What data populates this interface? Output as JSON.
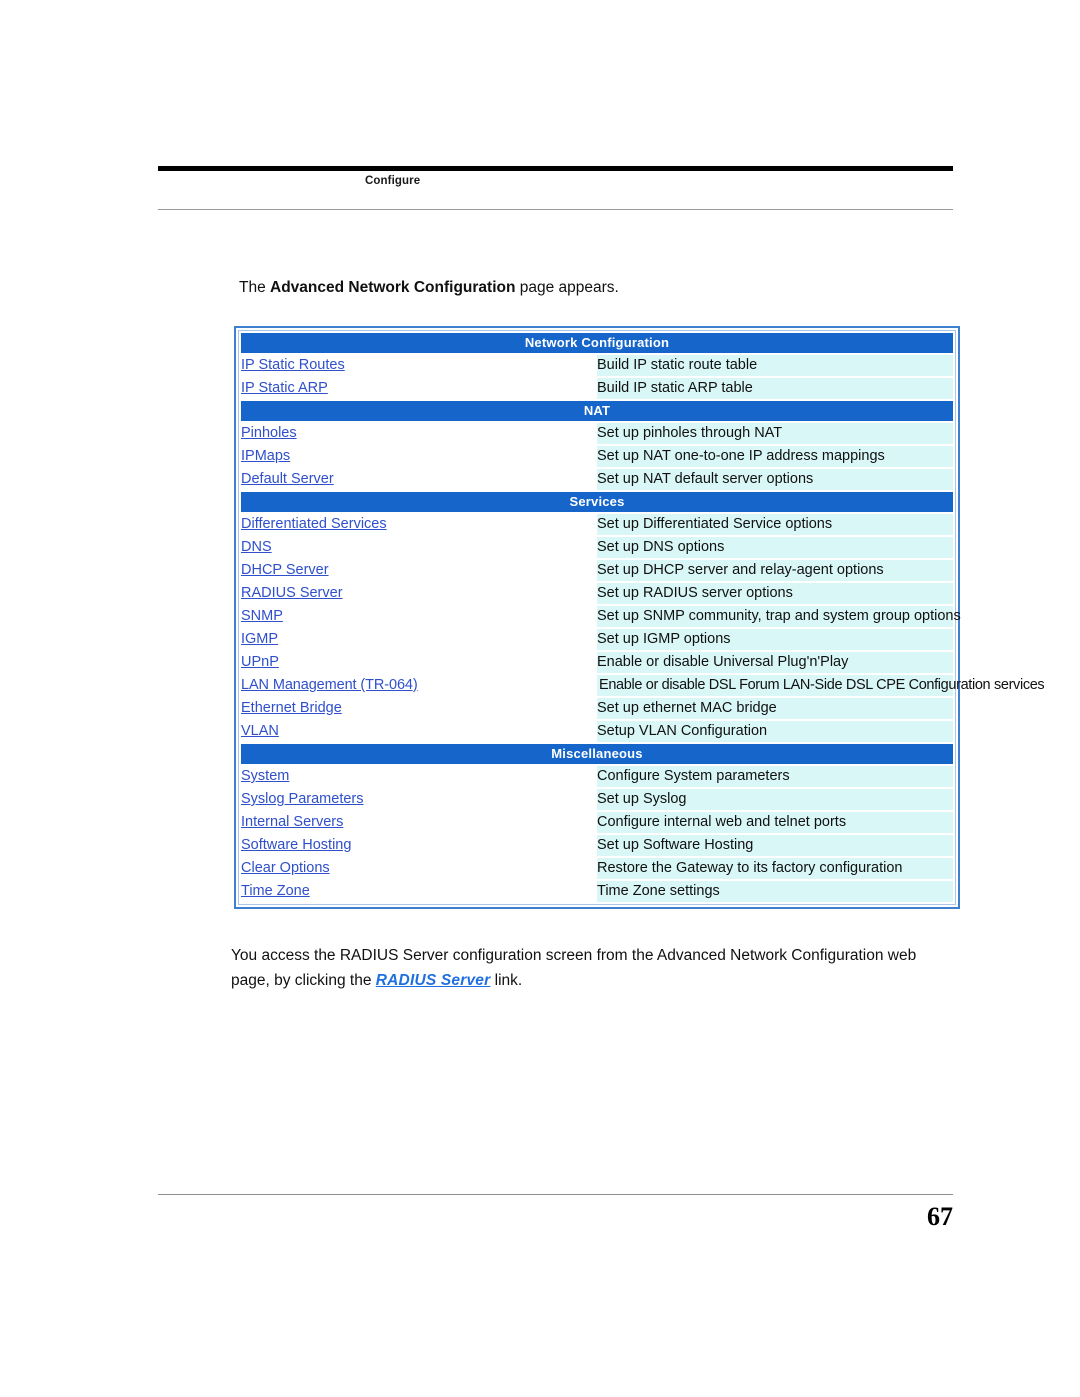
{
  "header": {
    "running_head": "Configure"
  },
  "intro": {
    "prefix": "The ",
    "bold": "Advanced Network Configuration",
    "suffix": " page appears."
  },
  "screenshot": {
    "name": "advanced-network-configuration-page",
    "colors": {
      "section_header_bg": "#1565cb",
      "section_header_text": "#ffffff",
      "description_bg": "#d9f7f6",
      "link_text": "#2f4fcb",
      "outer_border": "#3f7fd0",
      "inner_border": "#a8c6ea"
    },
    "sections": [
      {
        "title": "Network Configuration",
        "rows": [
          {
            "link": "IP Static Routes",
            "desc": "Build IP static route table"
          },
          {
            "link": "IP Static ARP",
            "desc": "Build IP static ARP table"
          }
        ]
      },
      {
        "title": "NAT",
        "rows": [
          {
            "link": "Pinholes",
            "desc": "Set up pinholes through NAT"
          },
          {
            "link": "IPMaps",
            "desc": "Set up NAT one-to-one IP address mappings"
          },
          {
            "link": "Default Server",
            "desc": "Set up NAT default server options"
          }
        ]
      },
      {
        "title": "Services",
        "rows": [
          {
            "link": "Differentiated Services",
            "desc": "Set up Differentiated Service options"
          },
          {
            "link": "DNS",
            "desc": "Set up DNS options"
          },
          {
            "link": "DHCP Server",
            "desc": "Set up DHCP server and relay-agent options"
          },
          {
            "link": "RADIUS Server",
            "desc": "Set up RADIUS server options"
          },
          {
            "link": "SNMP",
            "desc": "Set up SNMP community, trap and system group options"
          },
          {
            "link": "IGMP",
            "desc": "Set up IGMP options"
          },
          {
            "link": "UPnP",
            "desc": "Enable or disable Universal Plug'n'Play"
          },
          {
            "link": "LAN Management (TR-064)",
            "desc": "Enable or disable DSL Forum LAN-Side DSL CPE Configuration services",
            "wide": true
          },
          {
            "link": "Ethernet Bridge",
            "desc": "Set up ethernet MAC bridge"
          },
          {
            "link": "VLAN",
            "desc": "Setup VLAN Configuration"
          }
        ]
      },
      {
        "title": "Miscellaneous",
        "rows": [
          {
            "link": "System",
            "desc": "Configure System parameters"
          },
          {
            "link": "Syslog Parameters",
            "desc": "Set up Syslog"
          },
          {
            "link": "Internal Servers",
            "desc": "Configure internal web and telnet ports"
          },
          {
            "link": "Software Hosting",
            "desc": "Set up Software Hosting"
          },
          {
            "link": "Clear Options",
            "desc": "Restore the Gateway to its factory configuration"
          },
          {
            "link": "Time Zone",
            "desc": "Time Zone settings"
          }
        ]
      }
    ]
  },
  "outro": {
    "before": "You access the RADIUS Server configuration screen from the Advanced Network Configuration web page, by clicking the ",
    "link": "RADIUS Server",
    "after": " link."
  },
  "footer": {
    "page_number": "67"
  }
}
